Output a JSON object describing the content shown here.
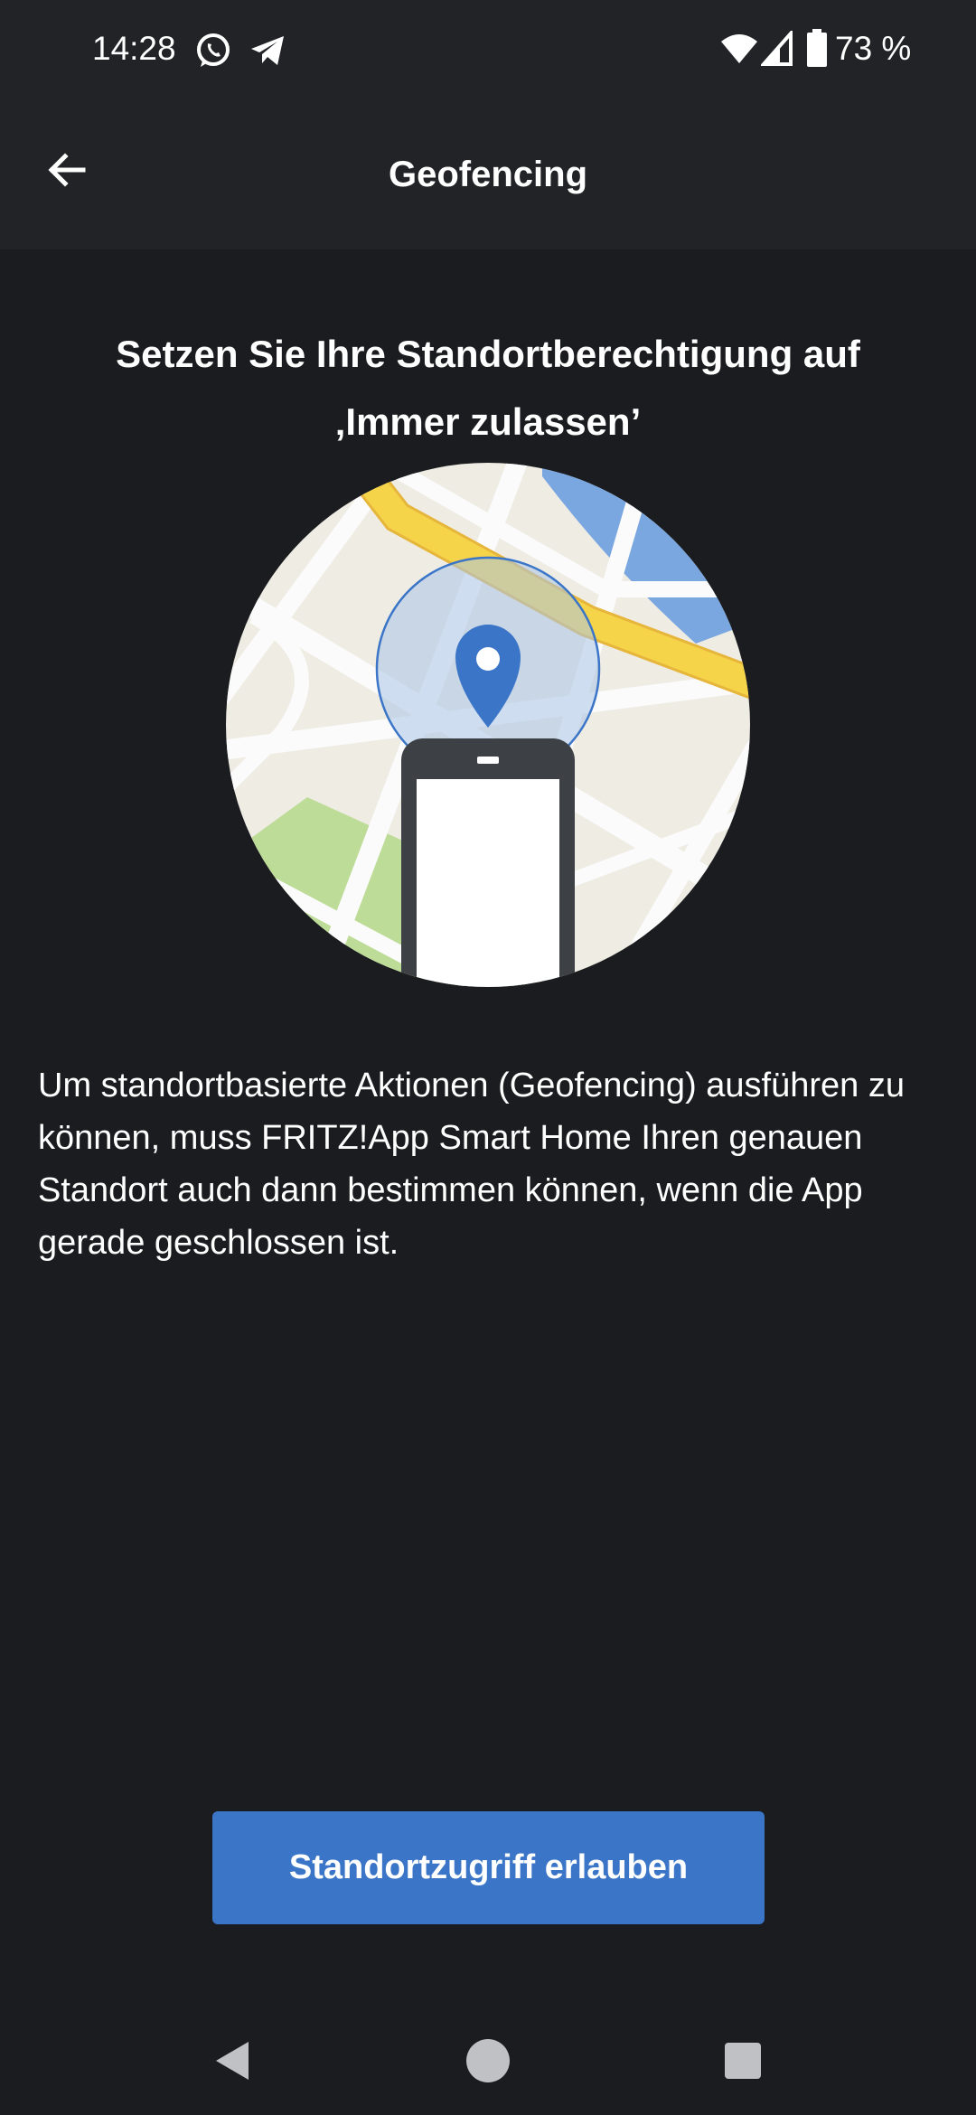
{
  "status_bar": {
    "time": "14:28",
    "battery": "73 %",
    "icons": [
      "whatsapp-icon",
      "telegram-icon",
      "wifi-icon",
      "signal-icon",
      "battery-icon"
    ]
  },
  "app_bar": {
    "title": "Geofencing",
    "back_icon": "arrow-left-icon"
  },
  "content": {
    "headline_line1": "Setzen Sie Ihre Standortberechtigung auf",
    "headline_line2": "‚Immer zulassen’",
    "illustration": "map-with-location-pin-and-phone",
    "description": "Um standortbasierte Aktionen (Geofencing) ausführen zu können, muss FRITZ!App Smart Home Ihren genauen Standort auch dann bestimmen können, wenn die App gerade geschlossen ist."
  },
  "actions": {
    "primary_label": "Standortzugriff erlauben"
  },
  "colors": {
    "background": "#1b1c1f",
    "app_bar": "#222327",
    "accent": "#3a75c8"
  },
  "nav": {
    "icons": [
      "back-triangle-icon",
      "home-circle-icon",
      "recents-square-icon"
    ]
  }
}
